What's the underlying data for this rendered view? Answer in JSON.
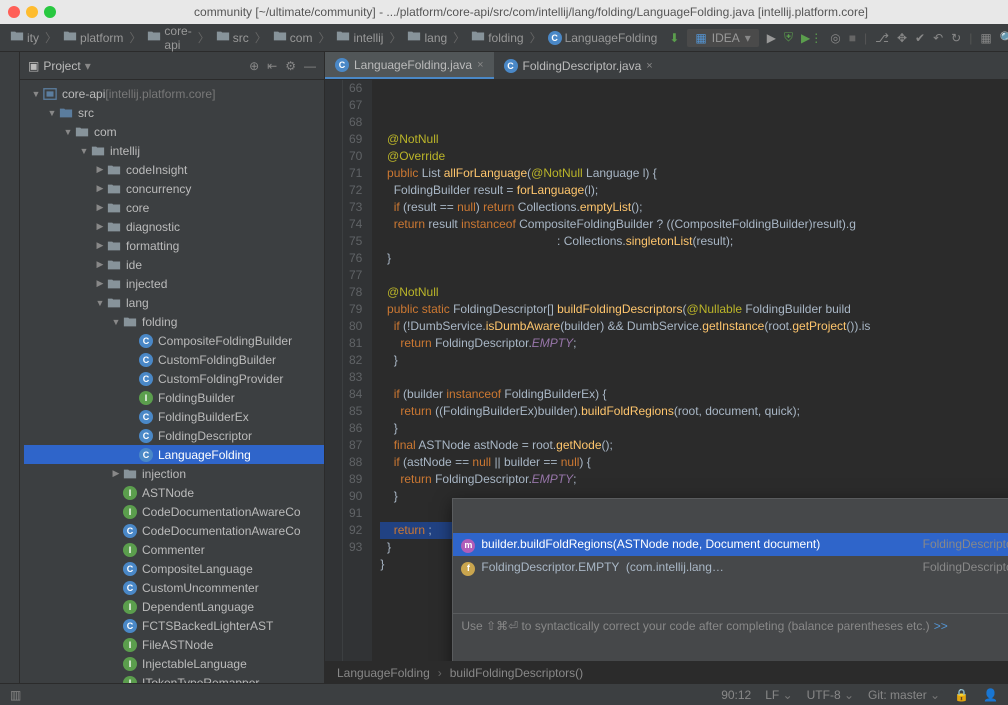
{
  "window": {
    "title": "community [~/ultimate/community] - .../platform/core-api/src/com/intellij/lang/folding/LanguageFolding.java [intellij.platform.core]"
  },
  "traffic": {
    "close": "#ff5f57",
    "min": "#febc2e",
    "max": "#28c840"
  },
  "breadcrumbs": [
    "ity",
    "platform",
    "core-api",
    "src",
    "com",
    "intellij",
    "lang",
    "folding",
    "LanguageFolding"
  ],
  "run_config": "IDEA",
  "project_panel": {
    "title": "Project",
    "tree": [
      {
        "d": 0,
        "arrow": "▼",
        "icon": "module",
        "label": "core-api",
        "suffix": "[intellij.platform.core]"
      },
      {
        "d": 1,
        "arrow": "▼",
        "icon": "src-folder",
        "label": "src"
      },
      {
        "d": 2,
        "arrow": "▼",
        "icon": "folder",
        "label": "com"
      },
      {
        "d": 3,
        "arrow": "▼",
        "icon": "folder",
        "label": "intellij"
      },
      {
        "d": 4,
        "arrow": "▶",
        "icon": "folder",
        "label": "codeInsight"
      },
      {
        "d": 4,
        "arrow": "▶",
        "icon": "folder",
        "label": "concurrency"
      },
      {
        "d": 4,
        "arrow": "▶",
        "icon": "folder",
        "label": "core"
      },
      {
        "d": 4,
        "arrow": "▶",
        "icon": "folder",
        "label": "diagnostic"
      },
      {
        "d": 4,
        "arrow": "▶",
        "icon": "folder",
        "label": "formatting"
      },
      {
        "d": 4,
        "arrow": "▶",
        "icon": "folder",
        "label": "ide"
      },
      {
        "d": 4,
        "arrow": "▶",
        "icon": "folder",
        "label": "injected"
      },
      {
        "d": 4,
        "arrow": "▼",
        "icon": "folder",
        "label": "lang"
      },
      {
        "d": 5,
        "arrow": "▼",
        "icon": "folder",
        "label": "folding"
      },
      {
        "d": 6,
        "arrow": "",
        "icon": "class-c",
        "label": "CompositeFoldingBuilder"
      },
      {
        "d": 6,
        "arrow": "",
        "icon": "class-c",
        "label": "CustomFoldingBuilder"
      },
      {
        "d": 6,
        "arrow": "",
        "icon": "class-c",
        "label": "CustomFoldingProvider"
      },
      {
        "d": 6,
        "arrow": "",
        "icon": "class-i",
        "label": "FoldingBuilder"
      },
      {
        "d": 6,
        "arrow": "",
        "icon": "class-c",
        "label": "FoldingBuilderEx"
      },
      {
        "d": 6,
        "arrow": "",
        "icon": "class-c",
        "label": "FoldingDescriptor"
      },
      {
        "d": 6,
        "arrow": "",
        "icon": "class-c",
        "label": "LanguageFolding",
        "selected": true
      },
      {
        "d": 5,
        "arrow": "▶",
        "icon": "folder",
        "label": "injection"
      },
      {
        "d": 5,
        "arrow": "",
        "icon": "class-i",
        "label": "ASTNode"
      },
      {
        "d": 5,
        "arrow": "",
        "icon": "class-i",
        "label": "CodeDocumentationAwareCo"
      },
      {
        "d": 5,
        "arrow": "",
        "icon": "class-c",
        "label": "CodeDocumentationAwareCo"
      },
      {
        "d": 5,
        "arrow": "",
        "icon": "class-i",
        "label": "Commenter"
      },
      {
        "d": 5,
        "arrow": "",
        "icon": "class-c",
        "label": "CompositeLanguage"
      },
      {
        "d": 5,
        "arrow": "",
        "icon": "class-c",
        "label": "CustomUncommenter"
      },
      {
        "d": 5,
        "arrow": "",
        "icon": "class-i",
        "label": "DependentLanguage"
      },
      {
        "d": 5,
        "arrow": "",
        "icon": "class-c",
        "label": "FCTSBackedLighterAST"
      },
      {
        "d": 5,
        "arrow": "",
        "icon": "class-i",
        "label": "FileASTNode"
      },
      {
        "d": 5,
        "arrow": "",
        "icon": "class-i",
        "label": "InjectableLanguage"
      },
      {
        "d": 5,
        "arrow": "",
        "icon": "class-i",
        "label": "ITokenTypeRemapper"
      }
    ]
  },
  "editor": {
    "tabs": [
      {
        "label": "LanguageFolding.java",
        "active": true,
        "icon": "class-c"
      },
      {
        "label": "FoldingDescriptor.java",
        "active": false,
        "icon": "class-c"
      }
    ],
    "first_line": 66,
    "lines": [
      "",
      "  @NotNull",
      "  @Override",
      "  public List<FoldingBuilder> allForLanguage(@NotNull Language l) {",
      "    FoldingBuilder result = forLanguage(l);",
      "    if (result == null) return Collections.emptyList();",
      "    return result instanceof CompositeFoldingBuilder ? ((CompositeFoldingBuilder)result).g",
      "                                                     : Collections.singletonList(result);",
      "  }",
      "",
      "  @NotNull",
      "  public static FoldingDescriptor[] buildFoldingDescriptors(@Nullable FoldingBuilder build",
      "    if (!DumbService.isDumbAware(builder) && DumbService.getInstance(root.getProject()).is",
      "      return FoldingDescriptor.EMPTY;",
      "    }",
      "",
      "    if (builder instanceof FoldingBuilderEx) {",
      "      return ((FoldingBuilderEx)builder).buildFoldRegions(root, document, quick);",
      "    }",
      "    final ASTNode astNode = root.getNode();",
      "    if (astNode == null || builder == null) {",
      "      return FoldingDescriptor.EMPTY;",
      "    }",
      "",
      "    return ;",
      "  }",
      "}",
      ""
    ],
    "highlight_index": 24,
    "popup": {
      "rows": [
        {
          "sel": true,
          "icon": "m",
          "sig": "builder.buildFoldRegions(ASTNode node, Document document)",
          "ret": "FoldingDescriptor[]"
        },
        {
          "sel": false,
          "icon": "f",
          "sig": "FoldingDescriptor.EMPTY  (com.intellij.lang…",
          "ret": "FoldingDescriptor[]"
        }
      ],
      "hint_pre": "Use ⇧⌘⏎ to syntactically correct your code after completing (balance parentheses etc.)",
      "hint_link": ">>"
    },
    "path": [
      "LanguageFolding",
      "buildFoldingDescriptors()"
    ]
  },
  "status": {
    "pos": "90:12",
    "le": "LF",
    "enc": "UTF-8",
    "git": "Git: master"
  }
}
